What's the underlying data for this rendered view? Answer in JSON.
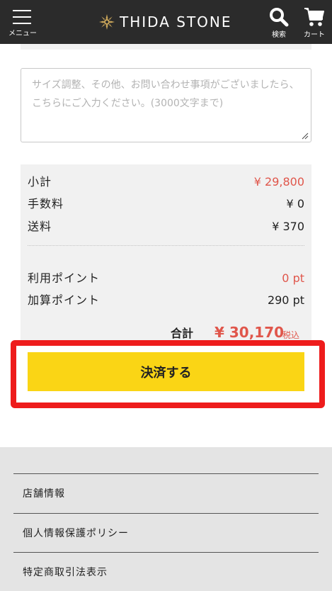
{
  "header": {
    "menu_label": "メニュー",
    "logo_text": "THIDA STONE",
    "search_label": "検索",
    "cart_label": "カート"
  },
  "note": {
    "placeholder": "サイズ調整、その他、お問い合わせ事項がございましたら、こちらにご入力ください。(3000文字まで)"
  },
  "summary": {
    "subtotal_label": "小計",
    "subtotal_value": "¥ 29,800",
    "fee_label": "手数料",
    "fee_value": "¥ 0",
    "shipping_label": "送料",
    "shipping_value": "¥ 370",
    "used_points_label": "利用ポイント",
    "used_points_value": "0 pt",
    "earned_points_label": "加算ポイント",
    "earned_points_value": "290 pt",
    "total_label": "合計",
    "total_value": "¥ 30,170",
    "tax_label": "税込"
  },
  "checkout": {
    "button_label": "決済する"
  },
  "footer": {
    "links": [
      "店舗情報",
      "個人情報保護ポリシー",
      "特定商取引法表示"
    ]
  },
  "colors": {
    "header_bg": "#2b2b2b",
    "accent_red": "#e0564b",
    "button_yellow": "#fad515",
    "highlight_red": "#ee1c1c"
  }
}
